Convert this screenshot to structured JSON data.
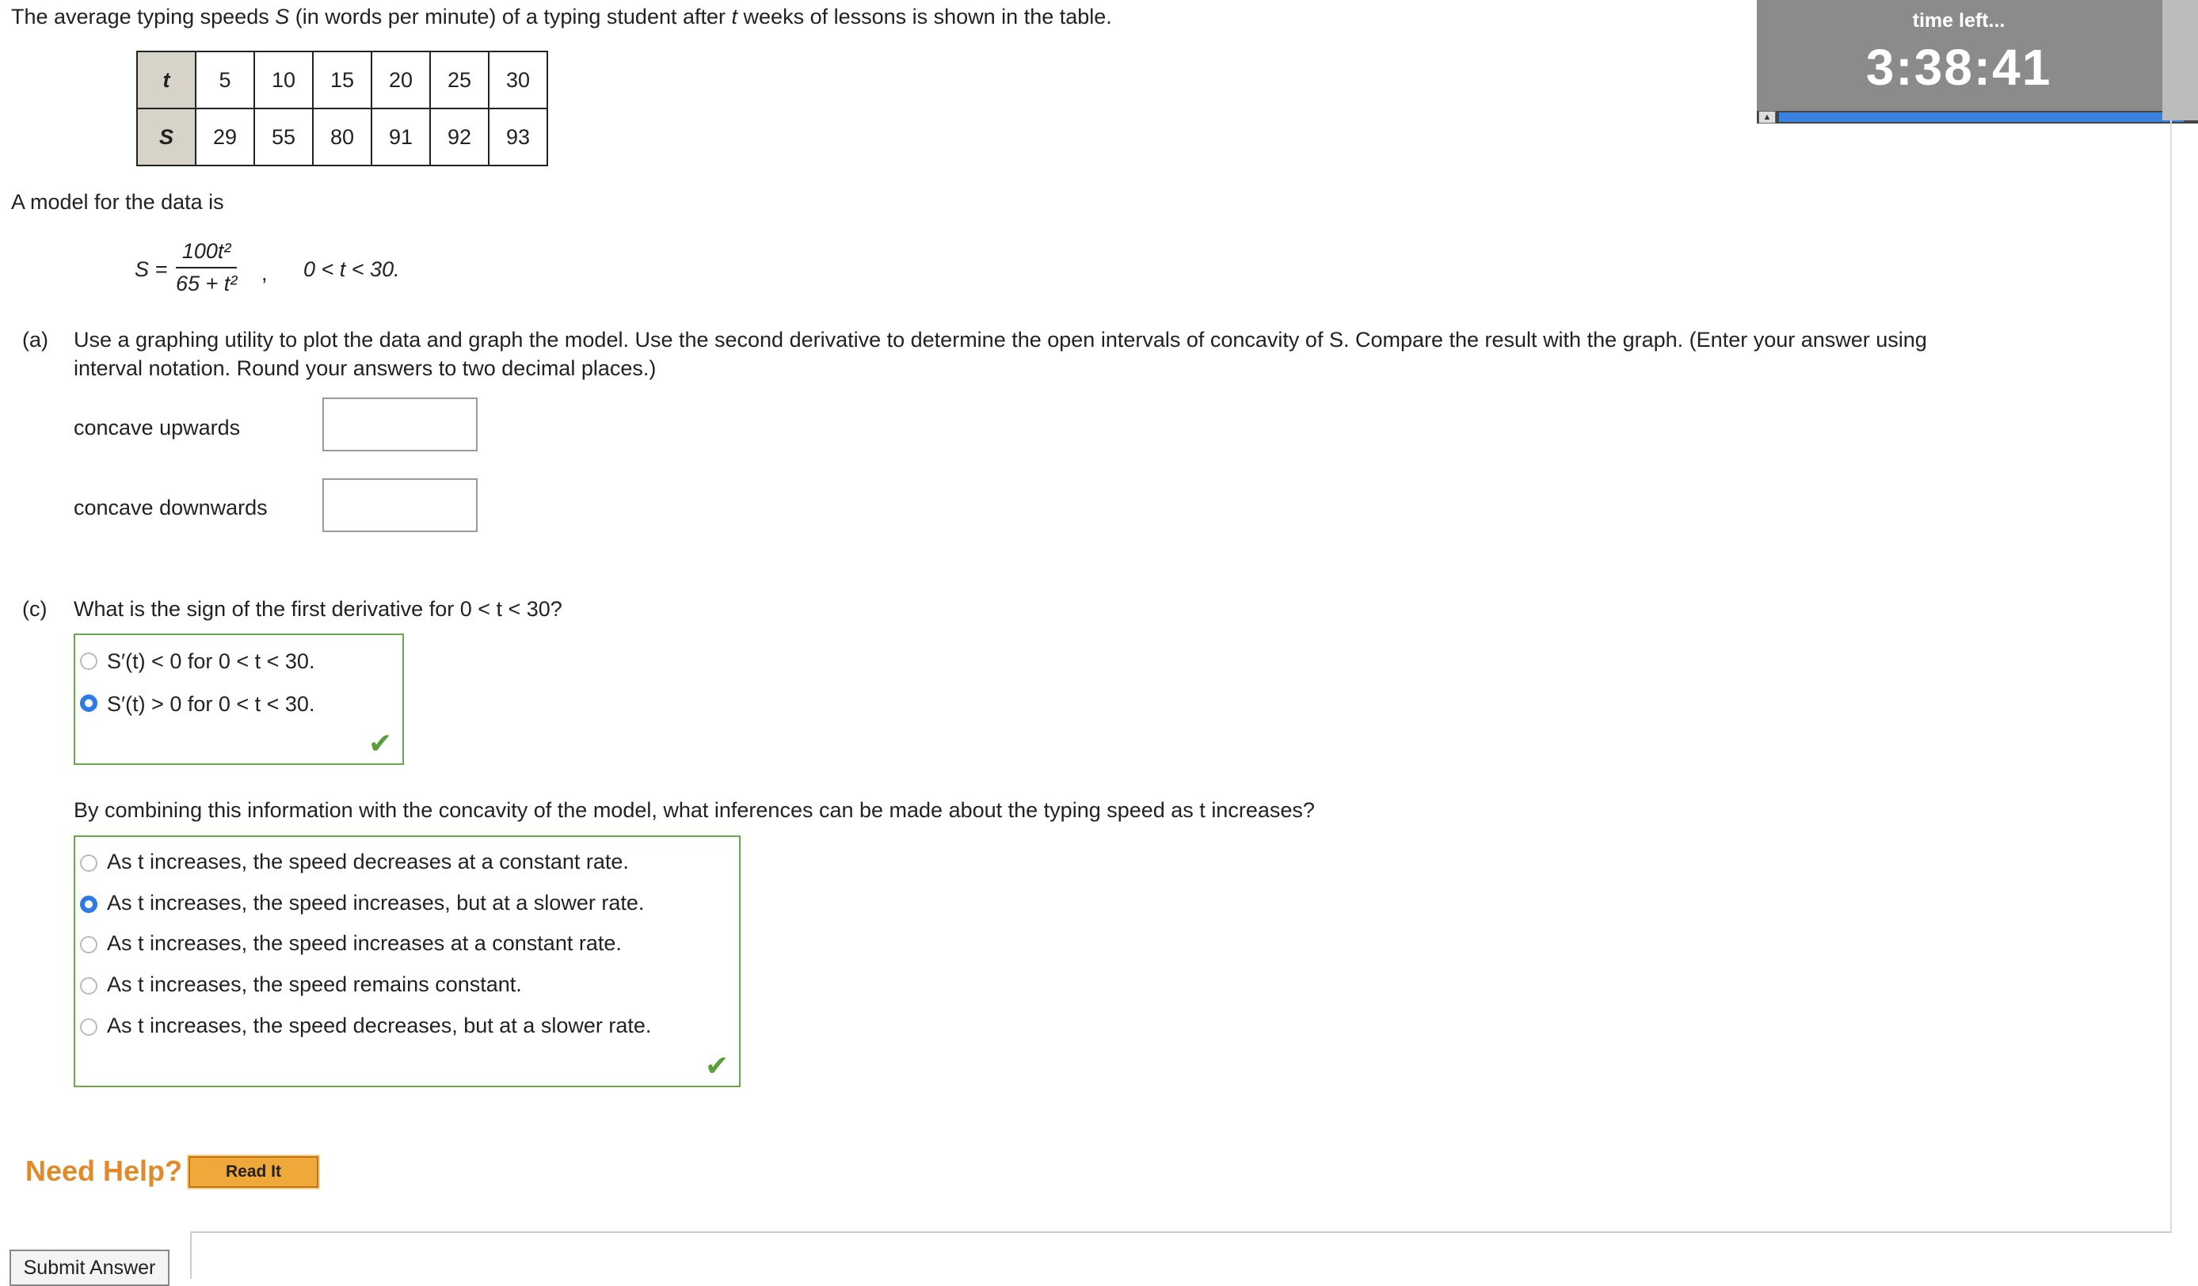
{
  "intro": {
    "text_before": "The average typing speeds ",
    "var_s": "S",
    "text_mid": " (in words per minute) of a typing student after ",
    "var_t": "t",
    "text_after": " weeks of lessons is shown in the table."
  },
  "table": {
    "t_label": "t",
    "s_label": "S",
    "t_values": [
      "5",
      "10",
      "15",
      "20",
      "25",
      "30"
    ],
    "s_values": [
      "29",
      "55",
      "80",
      "91",
      "92",
      "93"
    ]
  },
  "timer": {
    "label": "time left...",
    "value": "3:38:41",
    "progress_fraction": 0.97
  },
  "model": {
    "intro": "A model for the data is",
    "lhs": "S =",
    "numerator": "100t²",
    "denominator": "65 + t²",
    "comma": ",",
    "domain": "0 < t < 30."
  },
  "part_a": {
    "label": "(a)",
    "text": "Use a graphing utility to plot the data and graph the model. Use the second derivative to determine the open intervals of concavity of S. Compare the result with the graph. (Enter your answer using",
    "text2": "interval notation. Round your answers to two decimal places.)",
    "concave_up_label": "concave upwards",
    "concave_up_value": "",
    "concave_down_label": "concave downwards",
    "concave_down_value": ""
  },
  "part_c": {
    "label": "(c)",
    "question": "What is the sign of the first derivative for 0 < t < 30?",
    "options": [
      {
        "text": "S′(t) < 0 for 0 < t < 30.",
        "selected": false
      },
      {
        "text": "S′(t) > 0 for 0 < t < 30.",
        "selected": true
      }
    ],
    "followup": "By combining this information with the concavity of the model, what inferences can be made about the typing speed as t increases?",
    "options2": [
      {
        "text": "As t increases, the speed decreases at a constant rate.",
        "selected": false
      },
      {
        "text": "As t increases, the speed increases, but at a slower rate.",
        "selected": true
      },
      {
        "text": "As t increases, the speed increases at a constant rate.",
        "selected": false
      },
      {
        "text": "As t increases, the speed remains constant.",
        "selected": false
      },
      {
        "text": "As t increases, the speed decreases, but at a slower rate.",
        "selected": false
      }
    ],
    "check_symbol": "✔"
  },
  "help": {
    "need_help": "Need Help?",
    "read_it": "Read It"
  },
  "submit_label": "Submit Answer",
  "colors": {
    "correct_border": "#6aa84f",
    "radio_selected": "#2f7be6",
    "need_help": "#e08a2a",
    "timer_bg": "#8b8b8b"
  }
}
